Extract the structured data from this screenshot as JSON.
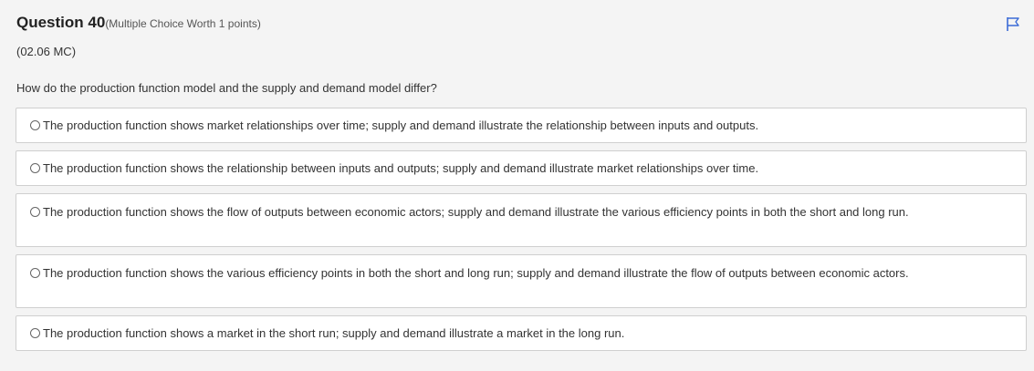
{
  "question": {
    "title": "Question 40",
    "worth": "(Multiple Choice Worth 1 points)",
    "code": "(02.06 MC)",
    "prompt": "How do the production function model and the supply and demand model differ?"
  },
  "options": [
    {
      "label": "The production function shows market relationships over time; supply and demand illustrate the relationship between inputs and outputs."
    },
    {
      "label": "The production function shows the relationship between inputs and outputs; supply and demand illustrate market relationships over time."
    },
    {
      "label": "The production function shows the flow of outputs between economic actors; supply and demand illustrate the various efficiency points in both the short and long run."
    },
    {
      "label": "The production function shows the various efficiency points in both the short and long run; supply and demand illustrate the flow of outputs between economic actors."
    },
    {
      "label": "The production function shows a market in the short run; supply and demand illustrate a market in the long run."
    }
  ],
  "colors": {
    "flag_accent": "#3b6bd6",
    "option_border": "#cfcfcf",
    "background": "#f4f4f4"
  },
  "icons": {
    "flag": "flag-icon",
    "radio": "radio-icon"
  }
}
